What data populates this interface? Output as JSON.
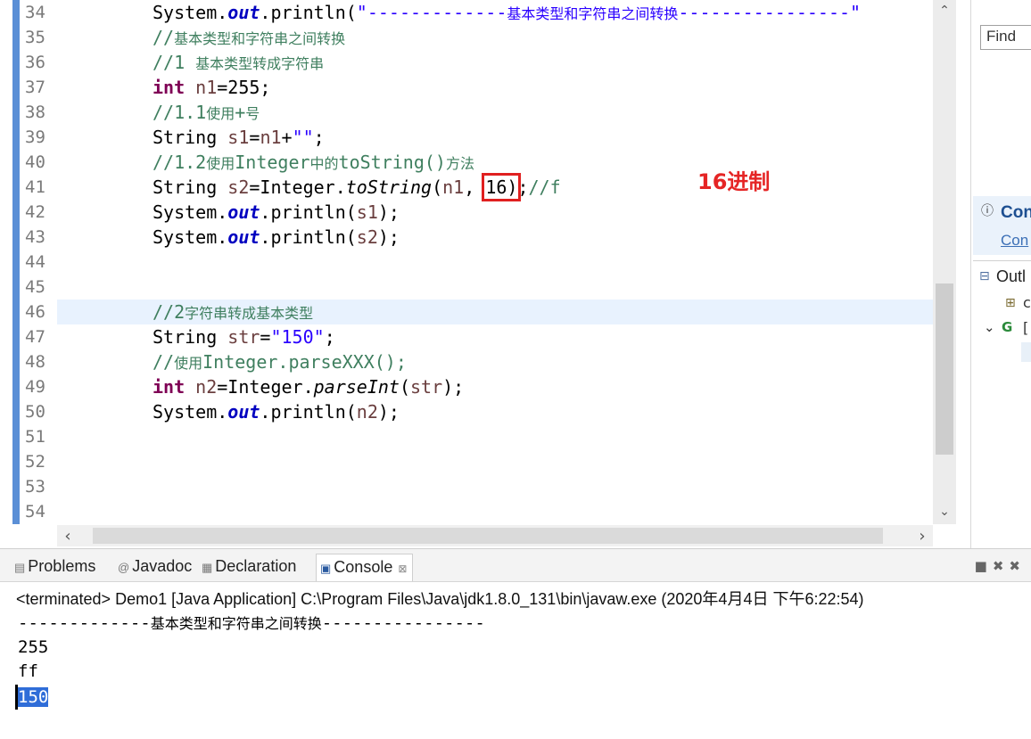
{
  "editor": {
    "line_numbers": [
      "34",
      "35",
      "36",
      "37",
      "38",
      "39",
      "40",
      "41",
      "42",
      "43",
      "44",
      "45",
      "46",
      "47",
      "48",
      "49",
      "50",
      "51",
      "52",
      "53",
      "54"
    ],
    "lines": {
      "l34": {
        "pre": "System.",
        "field": "out",
        "mid": ".println(",
        "str_a": "\"-------------",
        "str_cjk": "基本类型和字符串之间转换",
        "str_b": "----------------\""
      },
      "l35": {
        "comment_a": "//",
        "comment_cjk": "基本类型和字符串之间转换"
      },
      "l36": {
        "comment_a": "//1 ",
        "comment_cjk": "基本类型转成字符串"
      },
      "l37": {
        "kw": "int",
        "rest_a": " ",
        "var": "n1",
        "rest_b": "=255;"
      },
      "l38": {
        "comment_a": "//1.1",
        "comment_cjk": "使用",
        "comment_b": "+",
        "comment_cjk2": "号"
      },
      "l39": {
        "pre": "String ",
        "var": "s1",
        "eq": "=",
        "var2": "n1",
        "plus": "+",
        "str": "\"\"",
        "end": ";"
      },
      "l40": {
        "comment_a": "//1.2",
        "comment_cjk": "使用",
        "comment_b": "Integer",
        "comment_cjk2": "中的",
        "comment_c": "toString()",
        "comment_cjk3": "方法"
      },
      "l41": {
        "pre": "String ",
        "var": "s2",
        "eq": "=Integer.",
        "method": "toString",
        "open": "(",
        "var2": "n1",
        "comma": ", ",
        "boxed": "16)",
        "end": ";",
        "comment": "//f"
      },
      "l42": {
        "pre": "System.",
        "field": "out",
        "mid": ".println(",
        "var": "s1",
        "end": ");"
      },
      "l43": {
        "pre": "System.",
        "field": "out",
        "mid": ".println(",
        "var": "s2",
        "end": ");"
      },
      "l46": {
        "comment_a": "//2",
        "comment_cjk": "字符串转成基本类型"
      },
      "l47": {
        "pre": "String ",
        "var": "str",
        "eq": "=",
        "str": "\"150\"",
        "end": ";"
      },
      "l48": {
        "comment_a": "//",
        "comment_cjk": "使用",
        "comment_b": "Integer.parseXXX();"
      },
      "l49": {
        "kw": "int",
        "rest_a": " ",
        "var": "n2",
        "eq": "=Integer.",
        "method": "parseInt",
        "open": "(",
        "var2": "str",
        "end": ");"
      },
      "l50": {
        "pre": "System.",
        "field": "out",
        "mid": ".println(",
        "var": "n2",
        "end": ");"
      }
    },
    "annotation": "16进制"
  },
  "right_panel": {
    "find_placeholder": "Find",
    "connector_title": "Con",
    "connector_link": "Con",
    "outline_title": "Outl"
  },
  "bottom_panel": {
    "tabs": [
      {
        "label": "Problems",
        "icon": "problems-icon"
      },
      {
        "label": "Javadoc",
        "icon": "javadoc-icon"
      },
      {
        "label": "Declaration",
        "icon": "declaration-icon"
      },
      {
        "label": "Console",
        "icon": "console-icon",
        "active": true
      }
    ],
    "close_glyph": "⊠",
    "status_line": "<terminated> Demo1 [Java Application] C:\\Program Files\\Java\\jdk1.8.0_131\\bin\\javaw.exe (2020年4月4日 下午6:22:54)",
    "output": {
      "line1_a": "-------------",
      "line1_cjk": "基本类型和字符串之间转换",
      "line1_b": "----------------",
      "line2": "255",
      "line3": "ff",
      "line4": "150"
    }
  },
  "colors": {
    "keyword": "#7f0055",
    "field": "#0000c0",
    "comment": "#3f7f5f",
    "string": "#2a00ff",
    "annotation": "#e52525",
    "selection": "#2f6dd8"
  }
}
